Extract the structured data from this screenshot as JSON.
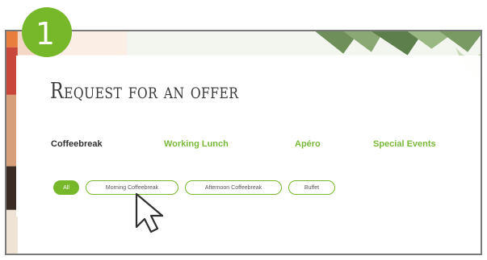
{
  "step": {
    "number": "1",
    "color": "#76b82a"
  },
  "page": {
    "title": "Request for an offer"
  },
  "tabs": [
    {
      "label": "Coffeebreak",
      "active": true
    },
    {
      "label": "Working Lunch",
      "active": false
    },
    {
      "label": "Apéro",
      "active": false
    },
    {
      "label": "Special Events",
      "active": false
    }
  ],
  "filters": [
    {
      "label": "All",
      "selected": true
    },
    {
      "label": "Morning Coffeebreak",
      "selected": false
    },
    {
      "label": "Afternoon Coffeebreak",
      "selected": false
    },
    {
      "label": "Buffet",
      "selected": false
    }
  ],
  "colors": {
    "accent": "#76b82a",
    "title_text": "#3a3a3a",
    "frame_border": "#7a7a7a"
  },
  "icons": {
    "cursor": "mouse-pointer-icon"
  }
}
